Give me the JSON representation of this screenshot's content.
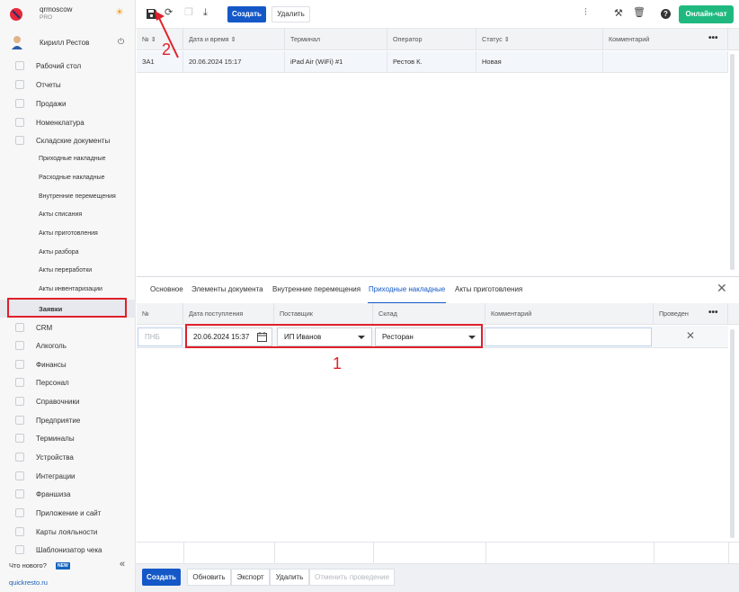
{
  "brand": {
    "name": "qrmoscow",
    "plan": "PRO"
  },
  "user": {
    "name": "Кирилл Рестов"
  },
  "sidebar": {
    "items": [
      {
        "label": "Рабочий стол",
        "icon": "speedometer-icon"
      },
      {
        "label": "Отчеты",
        "icon": "chart-icon"
      },
      {
        "label": "Продажи",
        "icon": "basket-icon"
      },
      {
        "label": "Номенклатура",
        "icon": "tag-icon"
      },
      {
        "label": "Складские документы",
        "icon": "warehouse-icon"
      },
      {
        "label": "Приходные накладные",
        "sub": true
      },
      {
        "label": "Расходные накладные",
        "sub": true
      },
      {
        "label": "Внутренние перемещения",
        "sub": true
      },
      {
        "label": "Акты списания",
        "sub": true
      },
      {
        "label": "Акты приготовления",
        "sub": true
      },
      {
        "label": "Акты разбора",
        "sub": true
      },
      {
        "label": "Акты переработки",
        "sub": true
      },
      {
        "label": "Акты инвентаризации",
        "sub": true
      },
      {
        "label": "Заявки",
        "sub": true,
        "active": true
      },
      {
        "label": "CRM",
        "icon": "people-icon"
      },
      {
        "label": "Алкоголь",
        "icon": "glass-icon"
      },
      {
        "label": "Финансы",
        "icon": "wallet-icon"
      },
      {
        "label": "Персонал",
        "icon": "staff-icon"
      },
      {
        "label": "Справочники",
        "icon": "book-icon"
      },
      {
        "label": "Предприятие",
        "icon": "store-icon"
      },
      {
        "label": "Терминалы",
        "icon": "terminal-icon"
      },
      {
        "label": "Устройства",
        "icon": "printer-icon"
      },
      {
        "label": "Интеграции",
        "icon": "link-icon"
      },
      {
        "label": "Франшиза",
        "icon": "org-icon"
      },
      {
        "label": "Приложение и сайт",
        "icon": "monitor-icon"
      },
      {
        "label": "Карты лояльности",
        "icon": "card-icon"
      },
      {
        "label": "Шаблонизатор чека",
        "icon": "receipt-icon"
      }
    ],
    "whats_new": "Что нового?",
    "new_badge": "NEW",
    "site": "quickresto.ru"
  },
  "toolbar": {
    "create": "Создать",
    "delete": "Удалить",
    "chat": "Онлайн-чат"
  },
  "list": {
    "headers": [
      "№ ⇕",
      "Дата и время ⇕",
      "Терминал",
      "Оператор",
      "Статус ⇕",
      "Комментарий"
    ],
    "rows": [
      {
        "no": "ЗА1",
        "datetime": "20.06.2024 15:17",
        "terminal": "iPad Air (WiFi) #1",
        "operator": "Рестов К.",
        "status": "Новая",
        "comment": ""
      }
    ]
  },
  "detail": {
    "tabs": [
      "Основное",
      "Элементы документа",
      "Внутренние перемещения",
      "Приходные накладные",
      "Акты приготовления"
    ],
    "selected_tab": 3,
    "headers": [
      "№",
      "Дата поступления",
      "Поставщик",
      "Склад",
      "Комментарий",
      "Проведен"
    ],
    "row": {
      "no_placeholder": "ПНБ",
      "date": "20.06.2024 15:37",
      "supplier": "ИП Иванов",
      "warehouse": "Ресторан",
      "comment": ""
    }
  },
  "annotations": {
    "one": "1",
    "two": "2"
  },
  "footer": {
    "create": "Создать",
    "refresh": "Обновить",
    "export": "Экспорт",
    "delete": "Удалить",
    "unpost": "Отменить проведение"
  },
  "colors": {
    "accent": "#1458c8",
    "green": "#1fb980",
    "highlight": "#e0202a"
  }
}
